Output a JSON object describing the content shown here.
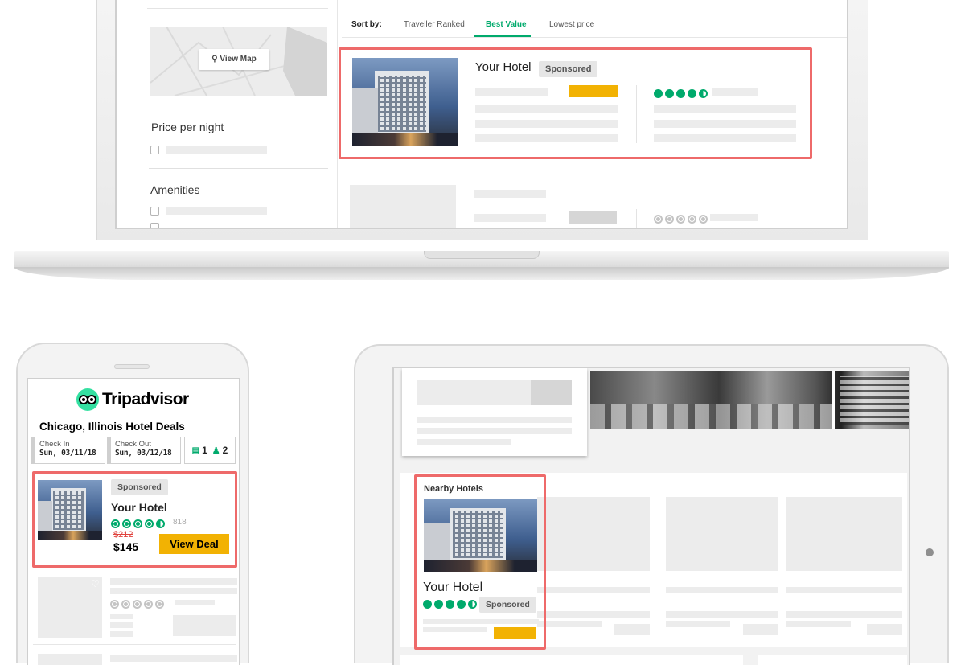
{
  "colors": {
    "accent_green": "#00aa6c",
    "highlight": "#ee6a6a",
    "deal_yellow": "#f2b203",
    "strike_red": "#e0433e"
  },
  "desktop": {
    "sort": {
      "label": "Sort by:",
      "options": [
        "Traveller Ranked",
        "Best Value",
        "Lowest price"
      ],
      "active": "Best Value"
    },
    "map_button": "View Map",
    "filters": {
      "price_title": "Price per night",
      "amenities_title": "Amenities"
    },
    "listing": {
      "name": "Your Hotel",
      "badge": "Sponsored",
      "rating_icon": "bubble-rating-icon"
    }
  },
  "mobile": {
    "logo_text": "Tripadvisor",
    "title": "Chicago, Illinois Hotel Deals",
    "check_in": {
      "label": "Check In",
      "value": "Sun, 03/11/18"
    },
    "check_out": {
      "label": "Check Out",
      "value": "Sun, 03/12/18"
    },
    "rooms": "1",
    "guests": "2",
    "listing": {
      "badge": "Sponsored",
      "name": "Your Hotel",
      "reviews": "818",
      "old_price": "$212",
      "price": "$145",
      "cta": "View Deal"
    }
  },
  "tablet": {
    "section_title": "Nearby Hotels",
    "listing": {
      "name": "Your Hotel",
      "badge": "Sponsored"
    }
  }
}
